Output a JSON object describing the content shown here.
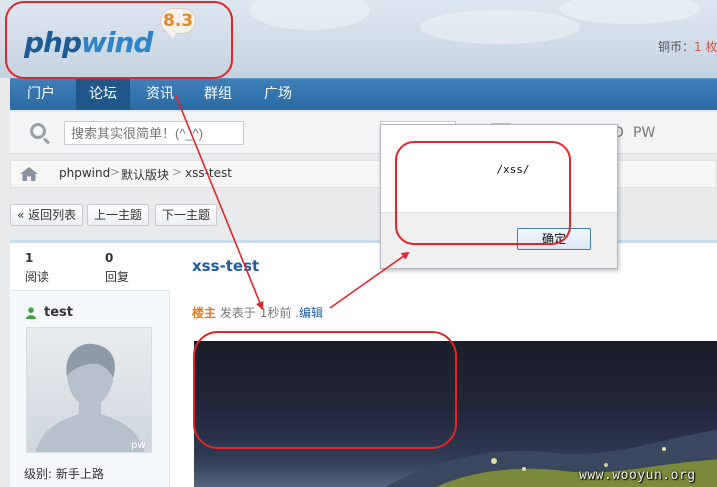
{
  "header": {
    "logo_part1": "php",
    "logo_part2": "wind",
    "version": "8.3",
    "coin_label": "铜币：",
    "coin_value": "1 枚"
  },
  "nav": {
    "items": [
      "门户",
      "论坛",
      "资讯",
      "群组",
      "广场"
    ],
    "active_index": 1
  },
  "search": {
    "placeholder": "搜索其实很简单！(^_^)",
    "d_label": "D",
    "pw_label": "PW"
  },
  "breadcrumb": {
    "items": [
      "phpwind",
      "默认版块",
      "xss-test"
    ],
    "separator": ">"
  },
  "toolbar": {
    "back_label": "« 返回列表",
    "prev_label": "上一主题",
    "next_label": "下一主题"
  },
  "post": {
    "read_count": "1",
    "read_label": "阅读",
    "reply_count": "0",
    "reply_label": "回复",
    "title": "xss-test",
    "author": "test",
    "level_label": "级别: 新手上路",
    "owner_label": "楼主",
    "posted_label": "发表于",
    "time": "1秒前",
    "dot": ".",
    "edit_label": "编辑",
    "avatar_badge": "pw"
  },
  "dialog": {
    "message": "/xss/",
    "ok_label": "确定"
  },
  "watermark": "www.wooyun.org",
  "colors": {
    "annotation": "#e3262a",
    "nav_bg": "#2a6aa3",
    "link": "#1d5da3",
    "owner": "#e07b22"
  }
}
